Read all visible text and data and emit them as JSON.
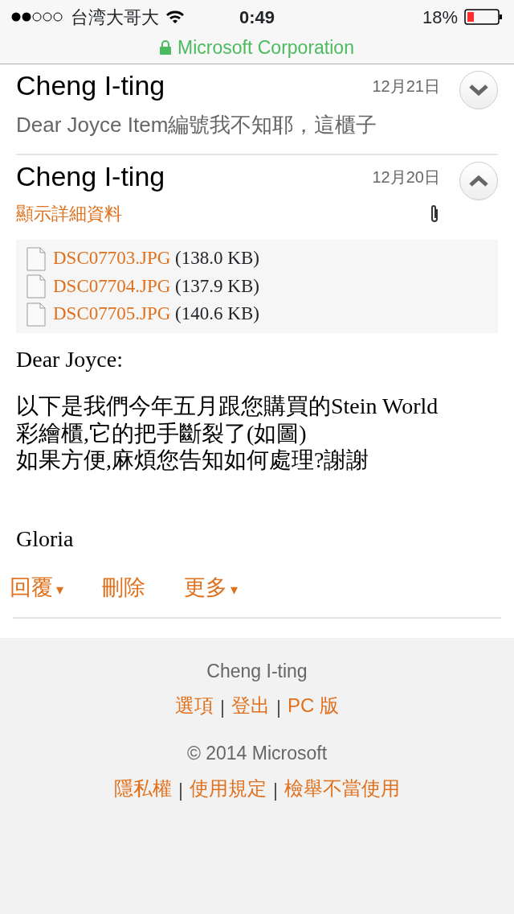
{
  "status_bar": {
    "carrier": "台湾大哥大",
    "time": "0:49",
    "battery": "18%"
  },
  "address_bar": {
    "site": "Microsoft Corporation"
  },
  "messages": [
    {
      "sender": "Cheng I-ting",
      "date": "12月21日",
      "expanded": false,
      "preview": "Dear Joyce Item編號我不知耶，這櫃子"
    },
    {
      "sender": "Cheng I-ting",
      "date": "12月20日",
      "expanded": true,
      "details_link": "顯示詳細資料",
      "attachments": [
        {
          "name": "DSC07703.JPG",
          "size": "(138.0 KB)"
        },
        {
          "name": "DSC07704.JPG",
          "size": "(137.9 KB)"
        },
        {
          "name": "DSC07705.JPG",
          "size": "(140.6 KB)"
        }
      ],
      "body": [
        [
          "Dear Joyce:"
        ],
        [
          "以下是我們今年五月跟您購買的Stein World 彩繪櫃,它的把手斷裂了(如圖)",
          "如果方便,麻煩您告知如何處理?謝謝"
        ]
      ],
      "signature": "Gloria"
    }
  ],
  "actions": [
    {
      "label": "回覆",
      "caret": "▾"
    },
    {
      "label": "刪除"
    },
    {
      "label": "更多",
      "caret": "▾"
    }
  ],
  "footer": {
    "user": "Cheng I-ting",
    "links": [
      "選項",
      "登出",
      "PC 版"
    ],
    "copyright": "© 2014 Microsoft",
    "legal_links": [
      "隱私權",
      "使用規定",
      "檢舉不當使用"
    ]
  }
}
